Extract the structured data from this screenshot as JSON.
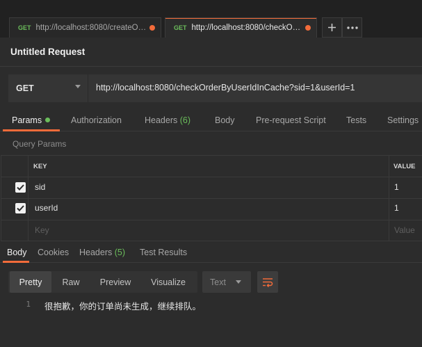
{
  "tabs": [
    {
      "method": "GET",
      "url": "http://localhost:8080/createOrd..."
    },
    {
      "method": "GET",
      "url": "http://localhost:8080/checkOrd..."
    }
  ],
  "tab_actions": {
    "add_icon": "plus-icon",
    "more_icon": "more-horizontal-icon"
  },
  "request": {
    "title": "Untitled Request",
    "method": "GET",
    "url": "http://localhost:8080/checkOrderByUserIdInCache?sid=1&userId=1"
  },
  "request_tabs": {
    "params": "Params",
    "authorization": "Authorization",
    "headers": "Headers",
    "headers_count": "(6)",
    "body": "Body",
    "prerequest": "Pre-request Script",
    "tests": "Tests",
    "settings": "Settings"
  },
  "query_params": {
    "label": "Query Params",
    "columns": {
      "key": "KEY",
      "value": "VALUE"
    },
    "rows": [
      {
        "checked": true,
        "key": "sid",
        "value": "1"
      },
      {
        "checked": true,
        "key": "userId",
        "value": "1"
      }
    ],
    "placeholder": {
      "key": "Key",
      "value": "Value"
    }
  },
  "response_tabs": {
    "body": "Body",
    "cookies": "Cookies",
    "headers": "Headers",
    "headers_count": "(5)",
    "test_results": "Test Results"
  },
  "response_toolbar": {
    "pretty": "Pretty",
    "raw": "Raw",
    "preview": "Preview",
    "visualize": "Visualize",
    "type": "Text",
    "wrap_icon": "wrap-lines-icon"
  },
  "response_body": {
    "line_number": "1",
    "text": "很抱歉，你的订单尚未生成，继续排队。"
  },
  "colors": {
    "accent": "#f26b3a",
    "get_method": "#6bbd5b",
    "background": "#2c2c2c"
  }
}
